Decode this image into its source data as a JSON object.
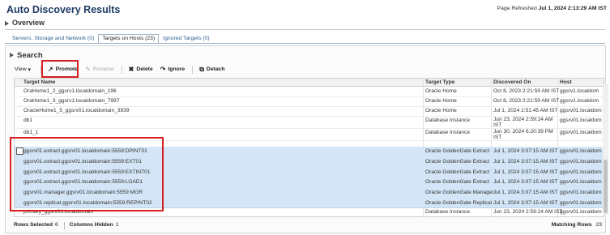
{
  "page": {
    "title": "Auto Discovery Results",
    "refreshed_label": "Page Refreshed",
    "refreshed_value": "Jul 1, 2024 2:13:29 AM IST"
  },
  "overview": {
    "label": "Overview"
  },
  "tabs": [
    {
      "label": "Servers, Storage and Network (0)"
    },
    {
      "label": "Targets on Hosts (23)"
    },
    {
      "label": "Ignored Targets (0)"
    }
  ],
  "search": {
    "label": "Search"
  },
  "toolbar": {
    "view": "View",
    "promote": "Promote",
    "rename": "Rename",
    "delete": "Delete",
    "ignore": "Ignore",
    "detach": "Detach"
  },
  "table": {
    "columns": [
      "Target Name",
      "Target Type",
      "Discovered On",
      "Host"
    ],
    "rows": [
      [
        "OraHome1_2_ggsrv1.localdomain_196",
        "Oracle Home",
        "Oct 8, 2023 2:21:59 AM IST",
        "ggsrv1.localdom"
      ],
      [
        "OraHome1_3_ggsrv1.localdomain_7997",
        "Oracle Home",
        "Oct 8, 2023 2:21:59 AM IST",
        "ggsrv1.localdom"
      ],
      [
        "OracleHome1_5_ggsrv01.localdomain_3939",
        "Oracle Home",
        "Jul 1, 2024 2:51:45 AM IST",
        "ggsrv01.localdom"
      ],
      [
        "db1",
        "Database Instance",
        "Jun 23, 2024 2:59:24 AM IST",
        "ggsrv01.localdom"
      ],
      [
        "db1_1",
        "Database Instance",
        "Jun 30, 2024 6:20:39 PM IST",
        "ggsrv01.localdom"
      ],
      [
        "ggsrv01.extract.ggsrv01.localdomain:5559:DPINT01",
        "Oracle GoldenGate Extract",
        "Jul 1, 2024 3:07:15 AM IST",
        "ggsrv01.localdom"
      ],
      [
        "ggsrv01.extract.ggsrv01.localdomain:5559:EXT01",
        "Oracle GoldenGate Extract",
        "Jul 1, 2024 3:07:15 AM IST",
        "ggsrv01.localdom"
      ],
      [
        "ggsrv01.extract.ggsrv01.localdomain:5559:EXTINT01",
        "Oracle GoldenGate Extract",
        "Jul 1, 2024 3:07:15 AM IST",
        "ggsrv01.localdom"
      ],
      [
        "ggsrv01.extract.ggsrv01.localdomain:5559:LOAD1",
        "Oracle GoldenGate Extract",
        "Jul 1, 2024 3:07:15 AM IST",
        "ggsrv01.localdom"
      ],
      [
        "ggsrv01.manager.ggsrv01.localdomain:5559:MGR",
        "Oracle GoldenGate Manager",
        "Jul 1, 2024 3:07:15 AM IST",
        "ggsrv01.localdom"
      ],
      [
        "ggsrv01.replicat.ggsrv01.localdomain:5559:REPINT02",
        "Oracle GoldenGate Replicat",
        "Jul 1, 2024 3:07:15 AM IST",
        "ggsrv01.localdom"
      ],
      [
        "primary_ggsrv01.localdomain",
        "Database Instance",
        "Jun 23, 2024 2:59:24 AM IST",
        "ggsrv01.localdom"
      ]
    ],
    "selected_rows": [
      5,
      6,
      7,
      8,
      9,
      10
    ]
  },
  "footer": {
    "rows_selected_label": "Rows Selected",
    "rows_selected_value": "6",
    "columns_hidden_label": "Columns Hidden",
    "columns_hidden_value": "1",
    "matching_rows_label": "Matching Rows",
    "matching_rows_value": "23"
  },
  "colors": {
    "highlight": "#d62020",
    "selection": "#d3e5f6",
    "title": "#1f3b63"
  }
}
